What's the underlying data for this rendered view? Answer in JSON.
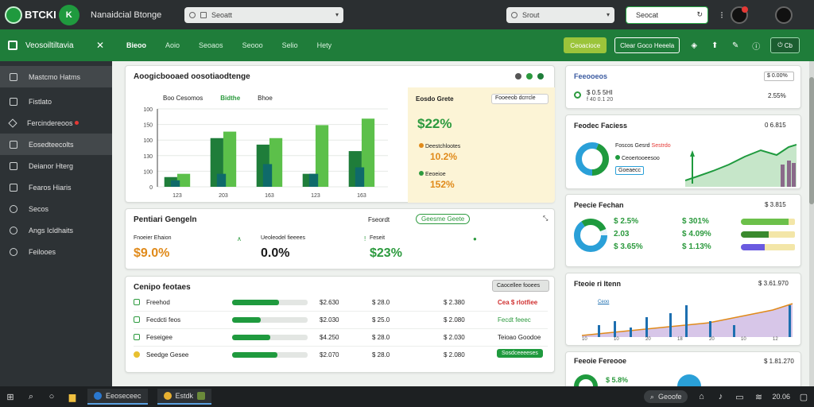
{
  "topbar": {
    "logo_text": "BTCKI",
    "logo_badge": "K",
    "title": "Nanaidcial Btonge",
    "search_placeholder": "Seoatt",
    "search2_placeholder": "Srout",
    "search3_value": "Seocat"
  },
  "sidebar": {
    "header": "Veosoiltiltavia",
    "items": [
      {
        "label": "Mastcmo Hatms"
      },
      {
        "label": "Fistlato"
      },
      {
        "label": "Fercindereoos"
      },
      {
        "label": "Eosedteecolts"
      },
      {
        "label": "Deianor Hterg"
      },
      {
        "label": "Fearos Hiaris"
      },
      {
        "label": "Secos"
      },
      {
        "label": "Angs Icldhaits"
      },
      {
        "label": "Feilooes"
      }
    ]
  },
  "nav": {
    "tabs": [
      "Bieoo",
      "Aoio",
      "Seoaos",
      "Seooo",
      "Selio",
      "Hety"
    ],
    "btn_primary": "Ceoacioce",
    "btn_outline": "Clear Goco Heeela",
    "btn_dark": "Cb"
  },
  "chart_card": {
    "title": "Aoogicbooaed oosotiaodtenge",
    "legend_a": "Boo Cesomos",
    "legend_b": "Bidthe",
    "legend_c": "Bhoe",
    "y_ticks": [
      "100",
      "150",
      "100",
      "130",
      "100",
      "0"
    ],
    "x_ticks": [
      "123",
      "203",
      "163",
      "123",
      "163"
    ],
    "side": {
      "title": "Eosdo Grete",
      "dropdown": "Fooeeob dcrrcle",
      "big_value": "$22%",
      "row1_label": "Deestchlootes",
      "row1_value": "10.2%",
      "row2_label": "Eeoeioe",
      "row2_value": "152%"
    }
  },
  "chart_data": {
    "type": "bar",
    "categories": [
      "123",
      "203",
      "163",
      "123",
      "163"
    ],
    "series": [
      {
        "values": [
          15,
          75,
          65,
          20,
          55
        ]
      },
      {
        "values": [
          20,
          85,
          75,
          95,
          105
        ]
      },
      {
        "values": [
          10,
          20,
          35,
          20,
          30
        ]
      }
    ],
    "ylim": [
      0,
      120
    ]
  },
  "perf_card": {
    "title": "Pentiari Gengeln",
    "action1": "Fseordt",
    "action2": "Geesme Geete",
    "kpis": [
      {
        "label": "Fnoeier Ehaion",
        "value": "$9.0%",
        "color": "#e08a1a"
      },
      {
        "label": "Ueoleodel fieeees",
        "value": "0.0%",
        "color": "#1a1a1a"
      },
      {
        "label": "Feseit",
        "value": "$23%",
        "color": "#2c9a3e"
      }
    ]
  },
  "table_card": {
    "title": "Cenipo feotaes",
    "button": "Caocellee fooees",
    "rows": [
      {
        "name": "Freehod",
        "pct": 0.62,
        "c1": "$2.630",
        "c2": "$ 28.0",
        "c3": "$ 2.380",
        "tag": "Cea $ rlotfiee",
        "tagtype": "red"
      },
      {
        "name": "Fecdcti feos",
        "pct": 0.38,
        "c1": "$2.030",
        "c2": "$ 25.0",
        "c3": "$ 2.080",
        "tag": "Fecdt feeec",
        "tagtype": "green"
      },
      {
        "name": "Feseigee",
        "pct": 0.5,
        "c1": "$4.250",
        "c2": "$ 28.0",
        "c3": "$ 2.030",
        "tag": "Teioao Goodoe",
        "tagtype": "plain"
      },
      {
        "name": "Seedge Gesee",
        "pct": 0.6,
        "c1": "$2.070",
        "c2": "$ 28.0",
        "c3": "$ 2.080",
        "tag": "Sosdceeeeses",
        "tagtype": "btn"
      }
    ]
  },
  "right_top": {
    "title": "Feeooeos",
    "value": "$ 0.00%",
    "row_label": "$ 0.5 5HI",
    "row_sub": "f 40 0.1 20",
    "row_value": "2.55%"
  },
  "right_donut": {
    "title": "Feodec Faciess",
    "value": "0 6.815",
    "l1": "Foscos Gesrd",
    "l1b": "Sestrdo",
    "l2": "Ceoertooeesoo",
    "l3": "Goeaecc"
  },
  "right_gauge": {
    "title": "Peecie Fechan",
    "value": "$ 3.815",
    "rows": [
      {
        "a": "$ 2.5%",
        "b": "$ 301%",
        "color": "#6cc04a",
        "pct": 0.88
      },
      {
        "a": "2.03",
        "b": "$ 4.09%",
        "color": "#3a8a2e",
        "pct": 0.5
      },
      {
        "a": "$ 3.65%",
        "b": "$ 1.13%",
        "color": "#6a5ae0",
        "pct": 0.42
      }
    ]
  },
  "right_area": {
    "title": "Fteoie ri Itenn",
    "value": "$ 3.61.970",
    "legend": "Ceoo",
    "x_ticks": [
      "10",
      "10",
      "20",
      "18",
      "20",
      "10",
      "12"
    ]
  },
  "right_bottom": {
    "title": "Feeoie Fereooe",
    "value": "$ 1.81.270",
    "s1": "$ 5.8%"
  },
  "taskbar": {
    "app1": "Eeoseceec",
    "app2": "Estdk",
    "search": "Geoofe",
    "time": "20.06"
  }
}
